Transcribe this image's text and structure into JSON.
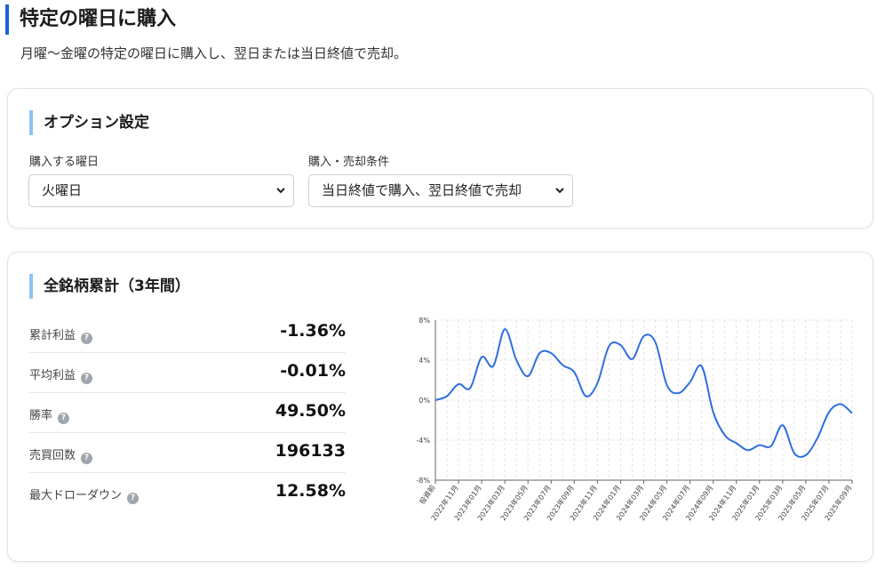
{
  "page": {
    "title": "特定の曜日に購入",
    "description": "月曜〜金曜の特定の曜日に購入し、翌日または当日終値で売却。"
  },
  "options": {
    "title": "オプション設定",
    "weekday_label": "購入する曜日",
    "weekday_value": "火曜日",
    "condition_label": "購入・売却条件",
    "condition_value": "当日終値で購入、翌日終値で売却"
  },
  "stats": {
    "title": "全銘柄累計（3年間）",
    "items": [
      {
        "label": "累計利益",
        "value": "-1.36%"
      },
      {
        "label": "平均利益",
        "value": "-0.01%"
      },
      {
        "label": "勝率",
        "value": "49.50%"
      },
      {
        "label": "売買回数",
        "value": "196133"
      },
      {
        "label": "最大ドローダウン",
        "value": "12.58%"
      }
    ]
  },
  "colors": {
    "accent": "#1a64d6",
    "line": "#2f6fde",
    "section_bar": "#8fc1f5"
  },
  "chart_data": {
    "type": "line",
    "ylim": [
      -8,
      8
    ],
    "yticks": [
      "8%",
      "4%",
      "0%",
      "-4%",
      "-8%"
    ],
    "ytick_values": [
      8,
      4,
      0,
      -4,
      -8
    ],
    "xticks": [
      "投資前",
      "2022年11月",
      "2023年01月",
      "2023年03月",
      "2023年05月",
      "2023年07月",
      "2023年09月",
      "2023年11月",
      "2024年01月",
      "2024年03月",
      "2024年05月",
      "2024年07月",
      "2024年09月",
      "2024年11月",
      "2025年01月",
      "2025年03月",
      "2025年05月",
      "2025年07月",
      "2025年09月"
    ],
    "x_count": 37,
    "values": [
      0,
      0.4,
      1.6,
      1.2,
      4.3,
      3.4,
      7.1,
      4.0,
      2.4,
      4.7,
      4.7,
      3.5,
      2.8,
      0.4,
      1.7,
      5.4,
      5.5,
      4.1,
      6.4,
      5.8,
      1.5,
      0.7,
      1.8,
      3.4,
      -1.2,
      -3.5,
      -4.3,
      -5.0,
      -4.5,
      -4.6,
      -2.5,
      -5.3,
      -5.5,
      -3.8,
      -1.2,
      -0.4,
      -1.3
    ]
  }
}
